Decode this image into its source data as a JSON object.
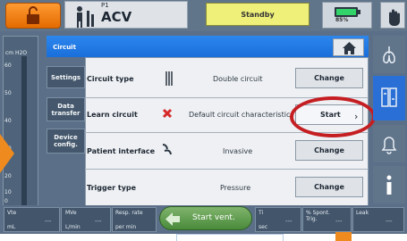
{
  "topbar": {
    "mode_small": "P1",
    "mode": "ACV",
    "status": "Standby",
    "battery": "85%"
  },
  "pressure_bar": {
    "unit": "cm H2O",
    "ticks": [
      "60",
      "50",
      "40",
      "30",
      "20",
      "10",
      "0"
    ]
  },
  "panel": {
    "title": "Circuit",
    "side_tabs": [
      "Settings",
      "Data transfer",
      "Device config."
    ],
    "rows": [
      {
        "label": "Circuit type",
        "value": "Double circuit",
        "button": "Change"
      },
      {
        "label": "Learn circuit",
        "value": "Default circuit characteristics",
        "button": "Start"
      },
      {
        "label": "Patient interface",
        "value": "Invasive",
        "button": "Change"
      },
      {
        "label": "Trigger type",
        "value": "Pressure",
        "button": "Change"
      }
    ]
  },
  "bottom": {
    "metrics": [
      {
        "label": "Vte",
        "unit": "mL",
        "value": "---"
      },
      {
        "label": "MVe",
        "unit": "L/min",
        "value": "---"
      },
      {
        "label": "Resp. rate",
        "unit": "per min",
        "value": "---"
      },
      {
        "label": "Ti",
        "unit": "sec",
        "value": "---"
      },
      {
        "label": "% Spont. Trig.",
        "unit": "",
        "value": "---"
      },
      {
        "label": "Leak",
        "unit": "",
        "value": "---"
      }
    ],
    "start_button": "Start vent."
  },
  "colors": {
    "accent_blue": "#1a6fda",
    "orange": "#ef8a1e",
    "highlight_ring": "#c51e22",
    "standby_yellow": "#eef07a"
  },
  "icons": [
    "lock-icon",
    "patient-icon",
    "battery-icon",
    "alarm-hand-icon",
    "home-icon",
    "lungs-icon",
    "settings-tool-icon",
    "bell-icon",
    "info-icon",
    "circuit-icon",
    "error-x-icon",
    "patient-interface-icon"
  ]
}
